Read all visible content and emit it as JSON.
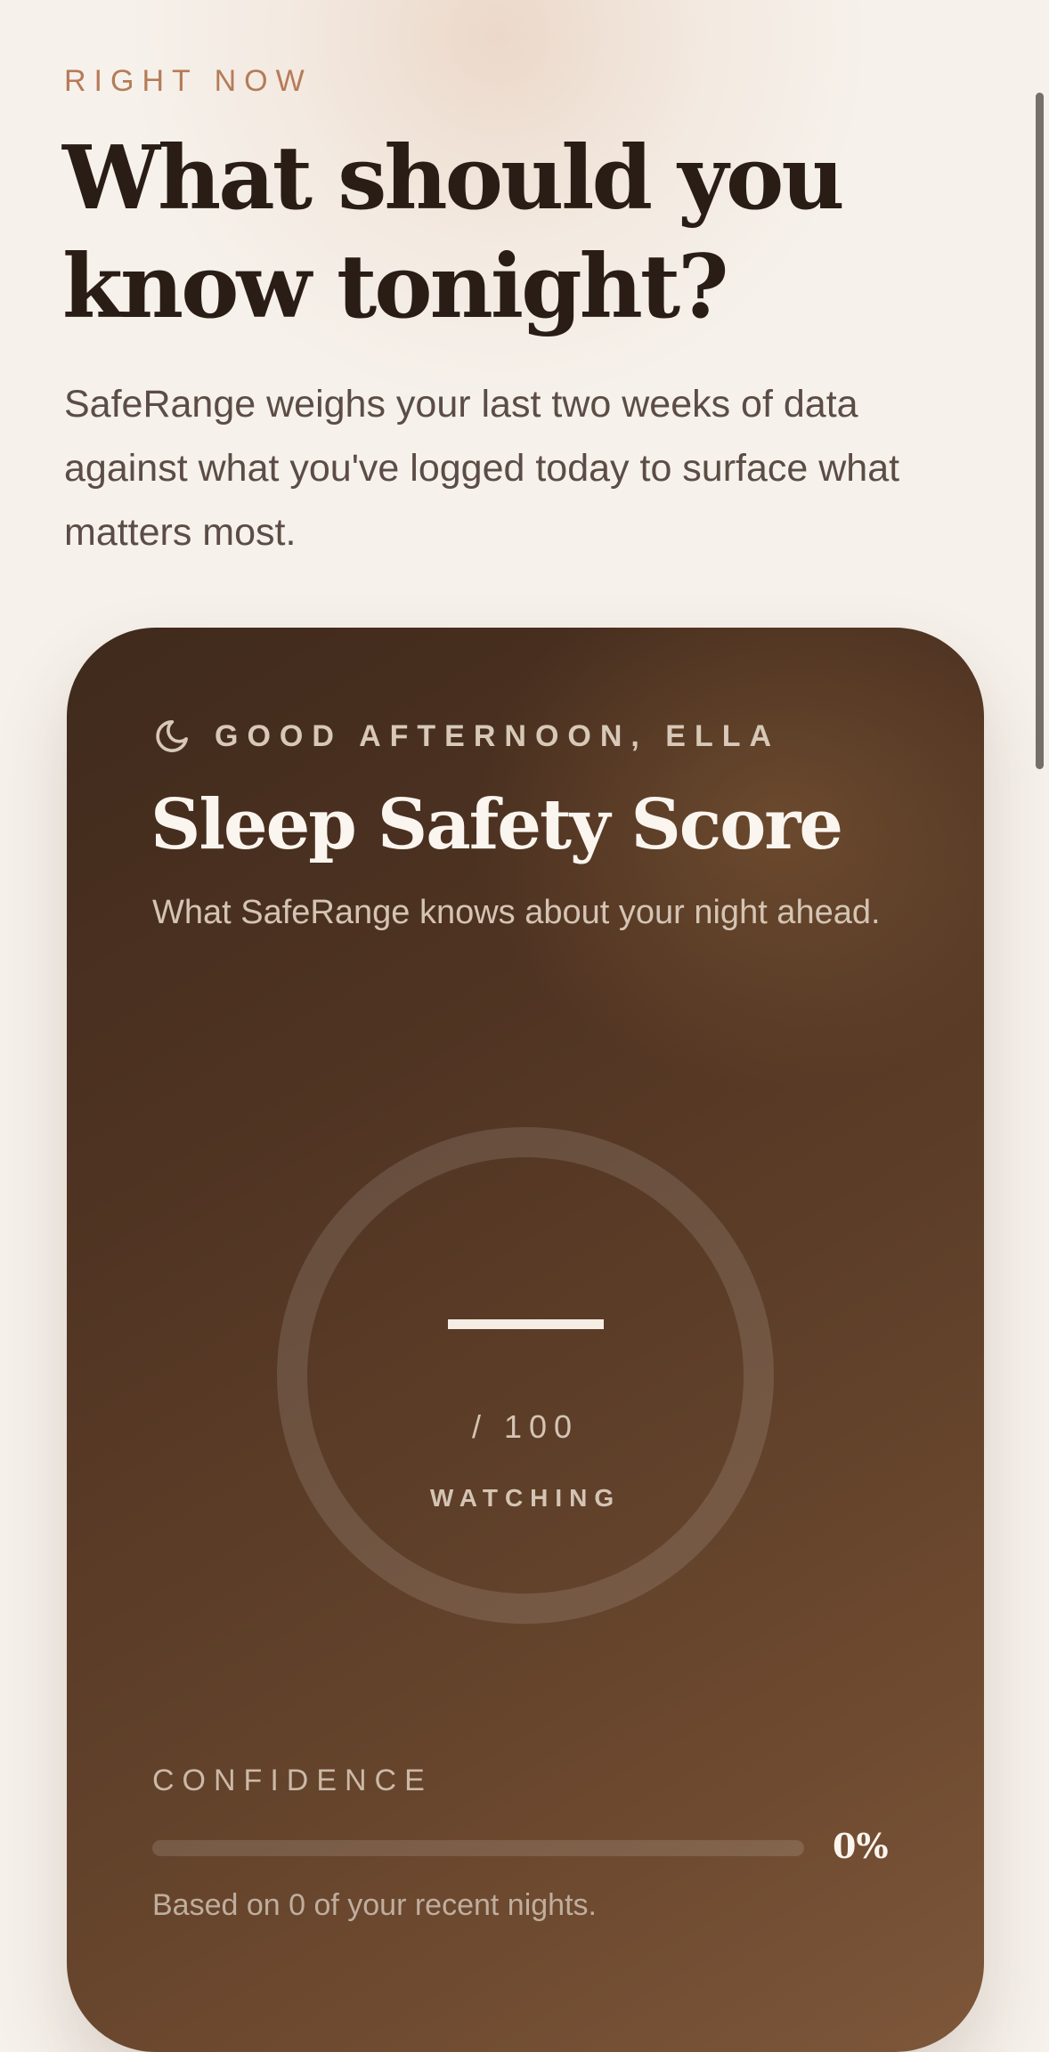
{
  "header": {
    "eyebrow": "RIGHT NOW",
    "headline": "What should you know tonight?",
    "intro": "SafeRange weighs your last two weeks of data against what you've logged today to surface what matters most."
  },
  "card": {
    "greeting_icon": "moon-icon",
    "greeting": "GOOD AFTERNOON, ELLA",
    "title": "Sleep Safety Score",
    "subtitle": "What SafeRange knows about your night ahead.",
    "score": {
      "value": "—",
      "max_label": "/ 100",
      "state": "WATCHING"
    },
    "confidence": {
      "label": "CONFIDENCE",
      "percent_label": "0%",
      "fraction": 0,
      "note": "Based on 0 of your recent nights."
    }
  },
  "colors": {
    "accent": "#b67b58",
    "card_dark": "#3f2a1c",
    "card_light": "#7e573a",
    "headline": "#2a1d16",
    "background": "#f6f1eb"
  }
}
